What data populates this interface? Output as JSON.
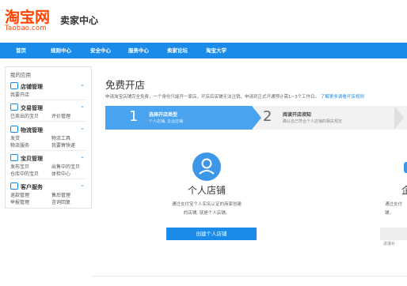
{
  "brand": {
    "logo_text": "淘宝网",
    "logo_sub": "Taobao.com",
    "seller_center": "卖家中心"
  },
  "nav": [
    "首页",
    "规则中心",
    "安全中心",
    "服务中心",
    "卖家论坛",
    "淘宝大学"
  ],
  "sidebar": {
    "title": "我的应用",
    "groups": [
      {
        "label": "店铺管理",
        "icon": "store-icon",
        "links": [
          "我要开店"
        ]
      },
      {
        "label": "交易管理",
        "icon": "trade-icon",
        "links": [
          "已卖出的宝贝",
          "评价管理"
        ]
      },
      {
        "label": "物流管理",
        "icon": "truck-icon",
        "links": [
          "发货",
          "物流工具",
          "物流服务",
          "我要寄快递"
        ]
      },
      {
        "label": "宝贝管理",
        "icon": "tag-icon",
        "links": [
          "发布宝贝",
          "出售中的宝贝",
          "仓库中的宝贝",
          "体检中心"
        ]
      },
      {
        "label": "客户服务",
        "icon": "service-icon",
        "links": [
          "退款管理",
          "售后管理",
          "举报管理",
          "咨询回复"
        ]
      }
    ]
  },
  "main": {
    "title": "免费开店",
    "notice": "申请淘宝店铺完全免费，一个身份只能开一家店，开店后店铺无法注销，申请到正式开通预计需1~3个工作日。",
    "notice_link": "了解更多请看开店规则",
    "steps": [
      {
        "num": "1",
        "title": "选择开店类型",
        "sub": "个人店铺, 企业店铺"
      },
      {
        "num": "2",
        "title": "阅读开店须知",
        "sub": "确认自己符合个人店铺的相关规定"
      }
    ],
    "card_personal": {
      "icon": "user-icon",
      "title": "个人店铺",
      "desc1": "通过支付宝个人实名认证的商家创建",
      "desc2": "的店铺, 就是个人店铺。",
      "button": "创建个人店铺"
    },
    "card_enterprise": {
      "title": "企",
      "desc1": "通过支付",
      "desc2": "铺，",
      "footer": "进填补"
    }
  }
}
